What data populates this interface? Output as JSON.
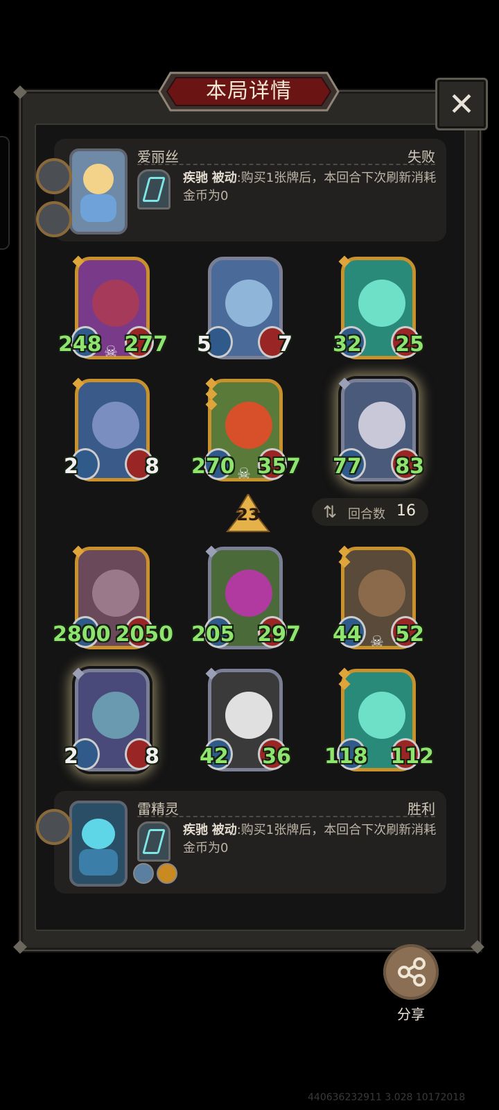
{
  "title": "本局详情",
  "close_icon": "close-icon",
  "top_player": {
    "name": "爱丽丝",
    "result": "失败",
    "skill_name": "疾驰",
    "skill_type": "被动",
    "skill_desc": ":购买1张牌后，本回合下次刷新消耗金币为0"
  },
  "top_cards": [
    {
      "atk": "248",
      "hp": "277",
      "stars": 1,
      "skull": true
    },
    {
      "atk": "5",
      "hp": "7",
      "stars": 0,
      "skull": false
    },
    {
      "atk": "32",
      "hp": "25",
      "stars": 1,
      "skull": false
    },
    {
      "atk": "2",
      "hp": "8",
      "stars": 1,
      "skull": false
    },
    {
      "atk": "270",
      "hp": "357",
      "stars": 3,
      "skull": true
    },
    {
      "atk": "77",
      "hp": "83",
      "stars": 1,
      "skull": false
    }
  ],
  "tavern_level": "23",
  "round": {
    "label": "回合数",
    "value": "16"
  },
  "bottom_cards": [
    {
      "atk": "2800",
      "hp": "2050",
      "stars": 1,
      "skull": false
    },
    {
      "atk": "205",
      "hp": "297",
      "stars": 1,
      "skull": false
    },
    {
      "atk": "44",
      "hp": "52",
      "stars": 2,
      "skull": true
    },
    {
      "atk": "2",
      "hp": "8",
      "stars": 1,
      "skull": false
    },
    {
      "atk": "42",
      "hp": "36",
      "stars": 1,
      "skull": false
    },
    {
      "atk": "118",
      "hp": "112",
      "stars": 2,
      "skull": false
    }
  ],
  "bottom_player": {
    "name": "雷精灵",
    "result": "胜利",
    "skill_name": "疾驰",
    "skill_type": "被动",
    "skill_desc": ":购买1张牌后，本回合下次刷新消耗金币为0"
  },
  "share_label": "分享",
  "watermark": "440636232911 3.028 10172018"
}
